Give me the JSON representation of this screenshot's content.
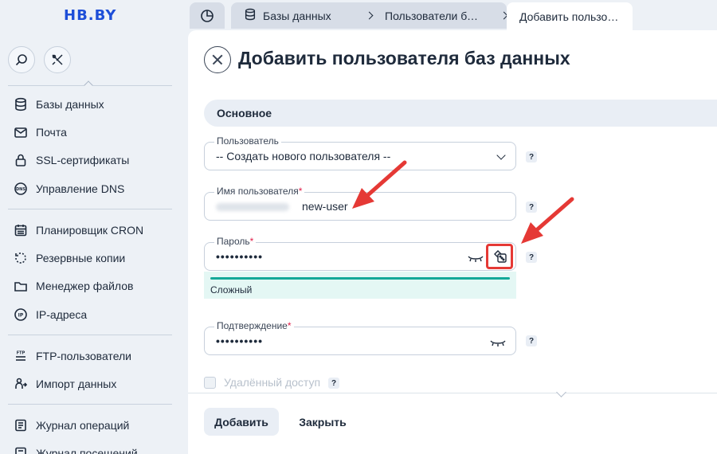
{
  "brand": {
    "logo": "HB.BY"
  },
  "sidebar": {
    "items": [
      {
        "label": "Базы данных",
        "icon": "database-icon"
      },
      {
        "label": "Почта",
        "icon": "mail-icon"
      },
      {
        "label": "SSL-сертификаты",
        "icon": "lock-icon"
      },
      {
        "label": "Управление DNS",
        "icon": "dns-icon"
      },
      {
        "label": "Планировщик CRON",
        "icon": "calendar-icon"
      },
      {
        "label": "Резервные копии",
        "icon": "backup-icon"
      },
      {
        "label": "Менеджер файлов",
        "icon": "folder-icon"
      },
      {
        "label": "IP-адреса",
        "icon": "ip-icon"
      },
      {
        "label": "FTP-пользователи",
        "icon": "ftp-icon"
      },
      {
        "label": "Импорт данных",
        "icon": "import-icon"
      },
      {
        "label": "Журнал операций",
        "icon": "journal-icon"
      },
      {
        "label": "Журнал посещений",
        "icon": "visits-icon"
      }
    ]
  },
  "breadcrumbs": {
    "items": [
      "Базы данных",
      "Пользователи баз данных"
    ],
    "active": "Добавить пользователя"
  },
  "form": {
    "title": "Добавить пользователя баз данных",
    "section": "Основное",
    "user_select": {
      "label": "Пользователь",
      "value": "-- Создать нового пользователя --"
    },
    "username": {
      "label": "Имя пользователя",
      "required": "*",
      "value": "new-user"
    },
    "password": {
      "label": "Пароль",
      "required": "*",
      "value": "••••••••••"
    },
    "strength": "Сложный",
    "confirm": {
      "label": "Подтверждение",
      "required": "*",
      "value": "••••••••••"
    },
    "remote_access": "Удалённый доступ",
    "help": "?",
    "submit": "Добавить",
    "close": "Закрыть"
  },
  "colors": {
    "accent": "#1d4ed8",
    "annotation": "#e53935",
    "strength": "#14a898"
  }
}
